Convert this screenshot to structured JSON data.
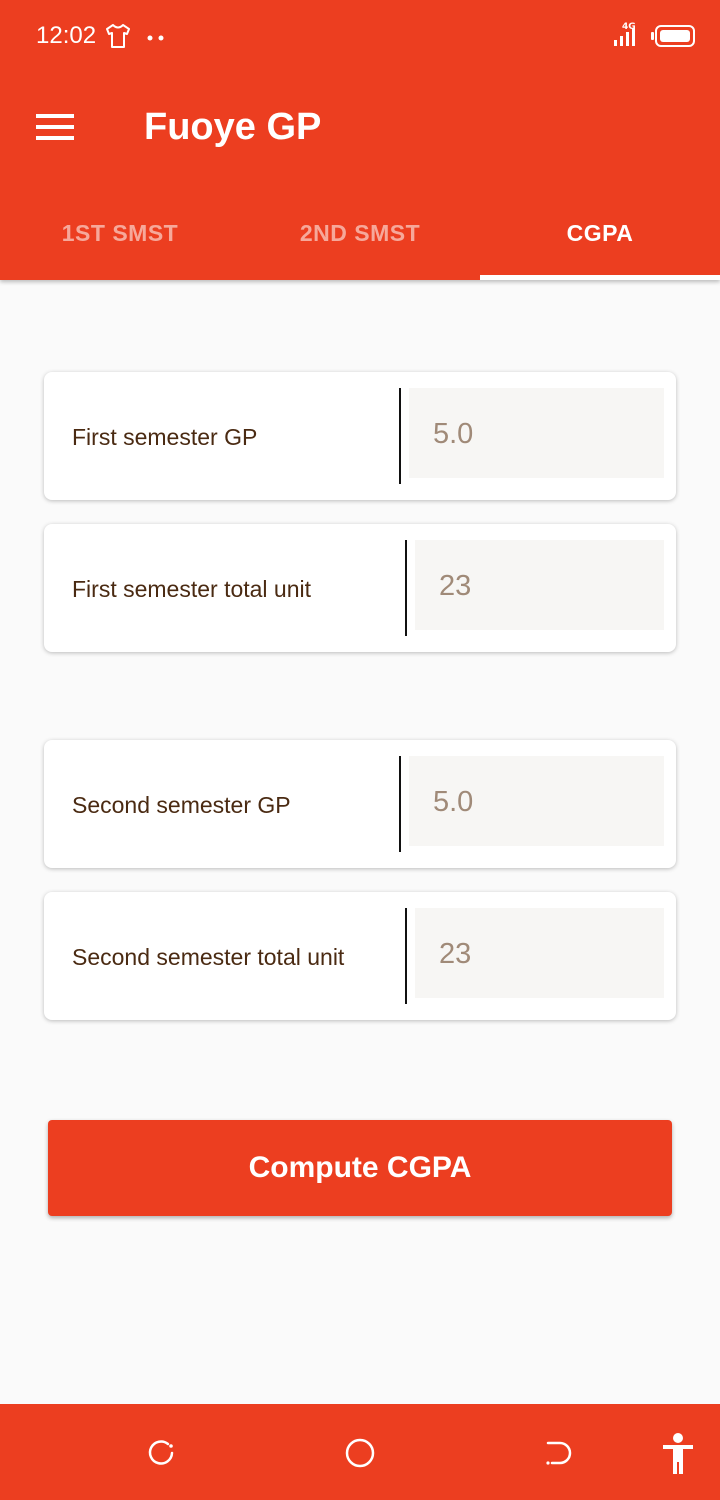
{
  "status_bar": {
    "time": "12:02",
    "network_label": "4G"
  },
  "app_bar": {
    "title": "Fuoye GP",
    "menu_icon": "hamburger-menu-icon"
  },
  "tabs": [
    {
      "label": "1ST SMST",
      "active": false
    },
    {
      "label": "2ND SMST",
      "active": false
    },
    {
      "label": "CGPA",
      "active": true
    }
  ],
  "fields": {
    "first_gp": {
      "label": "First semester GP",
      "placeholder": "5.0"
    },
    "first_unit": {
      "label": "First semester total unit",
      "placeholder": "23"
    },
    "second_gp": {
      "label": "Second semester GP",
      "placeholder": "5.0"
    },
    "second_unit": {
      "label": "Second semester total unit",
      "placeholder": "23"
    }
  },
  "compute_button": {
    "label": "Compute CGPA"
  },
  "colors": {
    "primary": "#ec3e20",
    "background": "#fafafa",
    "label_text": "#4a2a12",
    "placeholder_text": "#a08a78"
  },
  "nav_bar": {
    "icons": [
      "recents-icon",
      "home-icon",
      "back-icon",
      "accessibility-icon"
    ]
  }
}
